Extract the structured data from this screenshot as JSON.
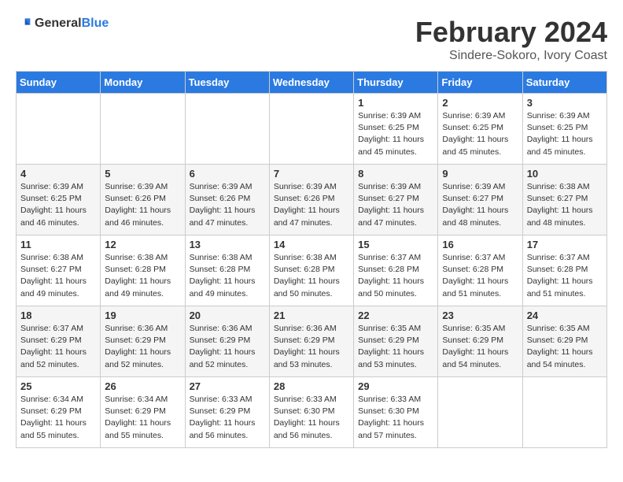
{
  "header": {
    "logo_general": "General",
    "logo_blue": "Blue",
    "month_title": "February 2024",
    "location": "Sindere-Sokoro, Ivory Coast"
  },
  "days_of_week": [
    "Sunday",
    "Monday",
    "Tuesday",
    "Wednesday",
    "Thursday",
    "Friday",
    "Saturday"
  ],
  "weeks": [
    [
      {
        "day": "",
        "info": ""
      },
      {
        "day": "",
        "info": ""
      },
      {
        "day": "",
        "info": ""
      },
      {
        "day": "",
        "info": ""
      },
      {
        "day": "1",
        "info": "Sunrise: 6:39 AM\nSunset: 6:25 PM\nDaylight: 11 hours\nand 45 minutes."
      },
      {
        "day": "2",
        "info": "Sunrise: 6:39 AM\nSunset: 6:25 PM\nDaylight: 11 hours\nand 45 minutes."
      },
      {
        "day": "3",
        "info": "Sunrise: 6:39 AM\nSunset: 6:25 PM\nDaylight: 11 hours\nand 45 minutes."
      }
    ],
    [
      {
        "day": "4",
        "info": "Sunrise: 6:39 AM\nSunset: 6:25 PM\nDaylight: 11 hours\nand 46 minutes."
      },
      {
        "day": "5",
        "info": "Sunrise: 6:39 AM\nSunset: 6:26 PM\nDaylight: 11 hours\nand 46 minutes."
      },
      {
        "day": "6",
        "info": "Sunrise: 6:39 AM\nSunset: 6:26 PM\nDaylight: 11 hours\nand 47 minutes."
      },
      {
        "day": "7",
        "info": "Sunrise: 6:39 AM\nSunset: 6:26 PM\nDaylight: 11 hours\nand 47 minutes."
      },
      {
        "day": "8",
        "info": "Sunrise: 6:39 AM\nSunset: 6:27 PM\nDaylight: 11 hours\nand 47 minutes."
      },
      {
        "day": "9",
        "info": "Sunrise: 6:39 AM\nSunset: 6:27 PM\nDaylight: 11 hours\nand 48 minutes."
      },
      {
        "day": "10",
        "info": "Sunrise: 6:38 AM\nSunset: 6:27 PM\nDaylight: 11 hours\nand 48 minutes."
      }
    ],
    [
      {
        "day": "11",
        "info": "Sunrise: 6:38 AM\nSunset: 6:27 PM\nDaylight: 11 hours\nand 49 minutes."
      },
      {
        "day": "12",
        "info": "Sunrise: 6:38 AM\nSunset: 6:28 PM\nDaylight: 11 hours\nand 49 minutes."
      },
      {
        "day": "13",
        "info": "Sunrise: 6:38 AM\nSunset: 6:28 PM\nDaylight: 11 hours\nand 49 minutes."
      },
      {
        "day": "14",
        "info": "Sunrise: 6:38 AM\nSunset: 6:28 PM\nDaylight: 11 hours\nand 50 minutes."
      },
      {
        "day": "15",
        "info": "Sunrise: 6:37 AM\nSunset: 6:28 PM\nDaylight: 11 hours\nand 50 minutes."
      },
      {
        "day": "16",
        "info": "Sunrise: 6:37 AM\nSunset: 6:28 PM\nDaylight: 11 hours\nand 51 minutes."
      },
      {
        "day": "17",
        "info": "Sunrise: 6:37 AM\nSunset: 6:28 PM\nDaylight: 11 hours\nand 51 minutes."
      }
    ],
    [
      {
        "day": "18",
        "info": "Sunrise: 6:37 AM\nSunset: 6:29 PM\nDaylight: 11 hours\nand 52 minutes."
      },
      {
        "day": "19",
        "info": "Sunrise: 6:36 AM\nSunset: 6:29 PM\nDaylight: 11 hours\nand 52 minutes."
      },
      {
        "day": "20",
        "info": "Sunrise: 6:36 AM\nSunset: 6:29 PM\nDaylight: 11 hours\nand 52 minutes."
      },
      {
        "day": "21",
        "info": "Sunrise: 6:36 AM\nSunset: 6:29 PM\nDaylight: 11 hours\nand 53 minutes."
      },
      {
        "day": "22",
        "info": "Sunrise: 6:35 AM\nSunset: 6:29 PM\nDaylight: 11 hours\nand 53 minutes."
      },
      {
        "day": "23",
        "info": "Sunrise: 6:35 AM\nSunset: 6:29 PM\nDaylight: 11 hours\nand 54 minutes."
      },
      {
        "day": "24",
        "info": "Sunrise: 6:35 AM\nSunset: 6:29 PM\nDaylight: 11 hours\nand 54 minutes."
      }
    ],
    [
      {
        "day": "25",
        "info": "Sunrise: 6:34 AM\nSunset: 6:29 PM\nDaylight: 11 hours\nand 55 minutes."
      },
      {
        "day": "26",
        "info": "Sunrise: 6:34 AM\nSunset: 6:29 PM\nDaylight: 11 hours\nand 55 minutes."
      },
      {
        "day": "27",
        "info": "Sunrise: 6:33 AM\nSunset: 6:29 PM\nDaylight: 11 hours\nand 56 minutes."
      },
      {
        "day": "28",
        "info": "Sunrise: 6:33 AM\nSunset: 6:30 PM\nDaylight: 11 hours\nand 56 minutes."
      },
      {
        "day": "29",
        "info": "Sunrise: 6:33 AM\nSunset: 6:30 PM\nDaylight: 11 hours\nand 57 minutes."
      },
      {
        "day": "",
        "info": ""
      },
      {
        "day": "",
        "info": ""
      }
    ]
  ]
}
